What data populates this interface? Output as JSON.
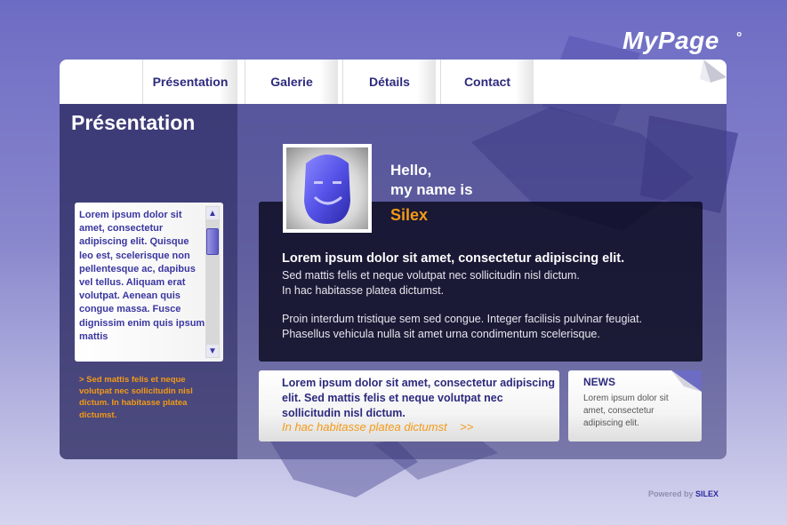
{
  "logo": {
    "text": "MyPage",
    "mark": "°"
  },
  "nav": {
    "tabs": [
      {
        "label": "Présentation"
      },
      {
        "label": "Galerie"
      },
      {
        "label": "Détails"
      },
      {
        "label": "Contact"
      }
    ]
  },
  "sidebar": {
    "title": "Présentation",
    "scroll_text": "Lorem ipsum dolor sit amet, consectetur adipiscing elit. Quisque leo est, scelerisque non pellentesque ac, dapibus vel tellus. Aliquam erat volutpat. Aenean quis congue massa. Fusce dignissim enim quis ipsum mattis",
    "scroll_up_icon": "▲",
    "scroll_down_icon": "▼",
    "link_text": "> Sed mattis felis et neque volutpat nec sollicitudin nisl dictum. In habitasse platea dictumst."
  },
  "profile": {
    "hello_line1": "Hello,",
    "hello_line2": "my name is",
    "name": "Silex"
  },
  "main": {
    "heading": "Lorem ipsum dolor sit amet, consectetur adipiscing elit.",
    "para1_line1": "Sed mattis felis et neque volutpat nec sollicitudin nisl dictum.",
    "para1_line2": "In hac habitasse platea dictumst.",
    "para2_line1": "Proin interdum tristique sem sed congue. Integer facilisis pulvinar feugiat.",
    "para2_line2": "Phasellus vehicula nulla sit amet urna condimentum scelerisque."
  },
  "card": {
    "text": "Lorem ipsum dolor sit amet, consectetur adipiscing elit. Sed mattis felis et neque volutpat nec sollicitudin nisl dictum.",
    "link": "In hac habitasse platea dictumst    >>"
  },
  "news": {
    "title": "NEWS",
    "body": "Lorem ipsum dolor sit amet, consectetur adipiscing elit."
  },
  "footer": {
    "powered_by": "Powered by",
    "brand": "SILEX"
  },
  "colors": {
    "accent_orange": "#f39a16",
    "nav_text": "#2d2a7e",
    "background": "#6d6cc4"
  },
  "icons": {
    "avatar": "smiley-face-icon",
    "page_curl": "page-curl-icon"
  }
}
